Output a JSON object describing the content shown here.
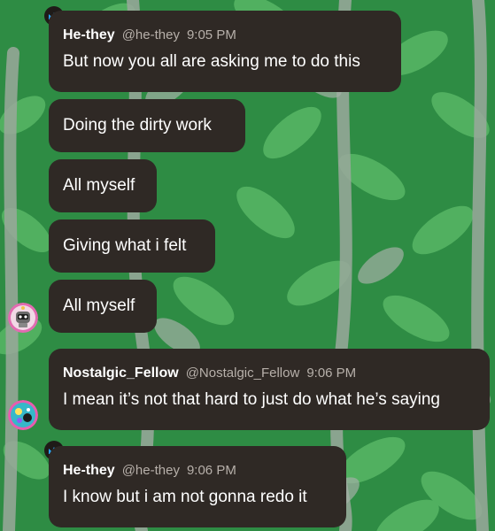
{
  "messages": [
    {
      "author": "He-they",
      "handle": "@he-they",
      "time": "9:05 PM",
      "text": "But now you all are asking me to do this"
    },
    {
      "text": "Doing the dirty work"
    },
    {
      "text": "All myself"
    },
    {
      "text": "Giving what i felt"
    },
    {
      "text": "All myself"
    },
    {
      "author": "Nostalgic_Fellow",
      "handle": "@Nostalgic_Fellow",
      "time": "9:06 PM",
      "text": "I mean it’s not that hard to just do what he’s saying"
    },
    {
      "author": "He-they",
      "handle": "@he-they",
      "time": "9:06 PM",
      "text": "I know but i am not gonna redo it"
    }
  ],
  "colors": {
    "bubble": "#2f2925",
    "background": "#2f8f45",
    "leaf": "#58b866",
    "stem": "#9aa89c",
    "crown": "#29a8ff"
  }
}
